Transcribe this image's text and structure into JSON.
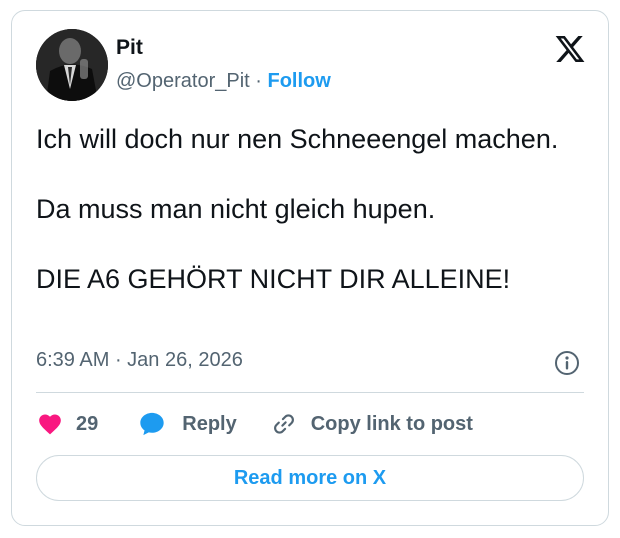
{
  "author": {
    "name": "Pit",
    "handle": "@Operator_Pit",
    "separator": " · ",
    "follow_label": "Follow"
  },
  "tweet": {
    "paragraphs": [
      "Ich will doch nur nen Schneeengel machen.",
      "Da muss man nicht gleich hupen.",
      "DIE A6 GEHÖRT NICHT DIR ALLEINE!"
    ],
    "time": "6:39 AM",
    "meta_separator": " · ",
    "date": "Jan 26, 2026"
  },
  "actions": {
    "like_count": "29",
    "reply_label": "Reply",
    "copy_label": "Copy link to post"
  },
  "read_more_label": "Read more on X",
  "icons": {
    "logo": "x-logo-icon",
    "info": "info-icon",
    "like": "heart-icon",
    "reply": "speech-bubble-icon",
    "copy": "link-icon"
  },
  "colors": {
    "accent": "#1d9bf0",
    "like": "#f91880",
    "text": "#0f1419",
    "secondary": "#536471",
    "border": "#cfd9de"
  }
}
